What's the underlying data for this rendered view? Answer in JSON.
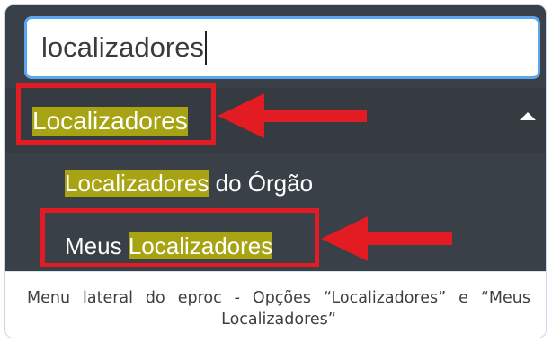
{
  "search": {
    "value": "localizadores"
  },
  "menu": {
    "group_label": "Localizadores",
    "items": [
      {
        "highlight": "Localizadores",
        "rest": " do Órgão"
      },
      {
        "prefix": "Meus ",
        "highlight": "Localizadores"
      }
    ]
  },
  "caption": "Menu lateral do eproc - Opções “Localizadores” e “Meus Localizadores”",
  "colors": {
    "menu_bg": "#3a4047",
    "highlight": "#a7a312",
    "annotation_red": "#e31b23",
    "input_border": "#5aa6f0"
  },
  "icons": [
    "chevron-up-icon",
    "red-arrow-annotation"
  ]
}
